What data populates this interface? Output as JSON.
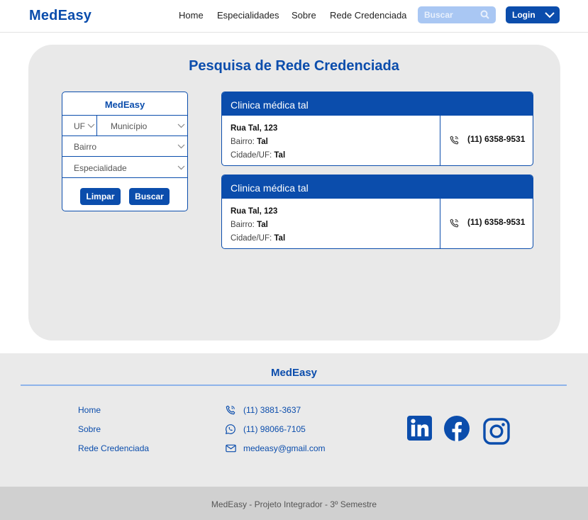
{
  "header": {
    "logo": "MedEasy",
    "nav": [
      "Home",
      "Especialidades",
      "Sobre",
      "Rede Credenciada"
    ],
    "search_placeholder": "Buscar",
    "login_label": "Login"
  },
  "main": {
    "title": "Pesquisa de Rede Credenciada",
    "filter": {
      "title": "MedEasy",
      "uf": "UF",
      "municipio": "Município",
      "bairro": "Bairro",
      "especialidade": "Especialidade",
      "clear_label": "Limpar",
      "search_label": "Buscar"
    },
    "results": [
      {
        "name": "Clinica médica tal",
        "street": "Rua Tal, 123",
        "bairro_label": "Bairro:",
        "bairro": "Tal",
        "city_label": "Cidade/UF:",
        "city": "Tal",
        "phone": "(11) 6358-9531"
      },
      {
        "name": "Clinica médica tal",
        "street": "Rua Tal, 123",
        "bairro_label": "Bairro:",
        "bairro": "Tal",
        "city_label": "Cidade/UF:",
        "city": "Tal",
        "phone": "(11) 6358-9531"
      }
    ]
  },
  "footer": {
    "logo": "MedEasy",
    "links": [
      "Home",
      "Sobre",
      "Rede Credenciada"
    ],
    "phone": "(11) 3881-3637",
    "whatsapp": "(11) 98066-7105",
    "email": "medeasy@gmail.com",
    "social_icons": [
      "linkedin-icon",
      "facebook-icon",
      "instagram-icon"
    ],
    "copyright": "MedEasy - Projeto Integrador - 3º Semestre"
  },
  "colors": {
    "primary": "#0b4dac",
    "search_bg": "#a9c7f3",
    "panel_bg": "#e9e9e9",
    "footer_bg": "#eaeaea",
    "bottom_bar": "#d0d0d0"
  }
}
